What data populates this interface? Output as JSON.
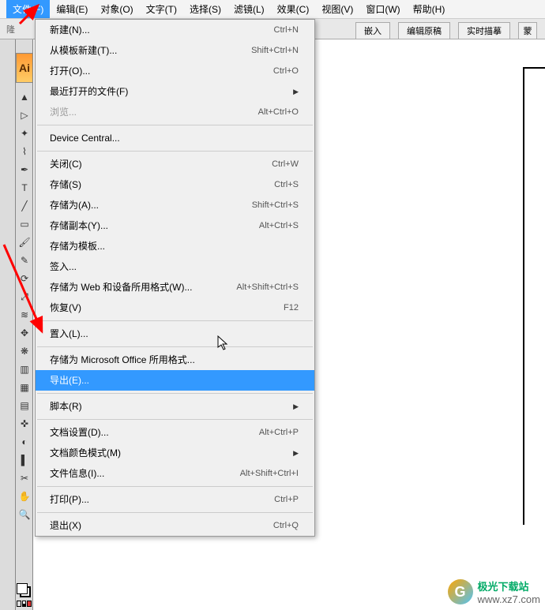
{
  "menubar": {
    "items": [
      {
        "label": "文件(F)",
        "active": true
      },
      {
        "label": "编辑(E)"
      },
      {
        "label": "对象(O)"
      },
      {
        "label": "文字(T)"
      },
      {
        "label": "选择(S)"
      },
      {
        "label": "滤镜(L)"
      },
      {
        "label": "效果(C)"
      },
      {
        "label": "视图(V)"
      },
      {
        "label": "窗口(W)"
      },
      {
        "label": "帮助(H)"
      }
    ]
  },
  "toolbar": {
    "embed": "嵌入",
    "edit_original": "编辑原稿",
    "live_trace": "实时描摹",
    "mask": "蒙"
  },
  "dropdown": {
    "items": [
      {
        "label": "新建(N)...",
        "shortcut": "Ctrl+N",
        "type": "item"
      },
      {
        "label": "从模板新建(T)...",
        "shortcut": "Shift+Ctrl+N",
        "type": "item"
      },
      {
        "label": "打开(O)...",
        "shortcut": "Ctrl+O",
        "type": "item"
      },
      {
        "label": "最近打开的文件(F)",
        "shortcut": "",
        "type": "submenu"
      },
      {
        "label": "浏览...",
        "shortcut": "Alt+Ctrl+O",
        "type": "item",
        "disabled": true
      },
      {
        "type": "sep"
      },
      {
        "label": "Device Central...",
        "shortcut": "",
        "type": "item"
      },
      {
        "type": "sep"
      },
      {
        "label": "关闭(C)",
        "shortcut": "Ctrl+W",
        "type": "item"
      },
      {
        "label": "存储(S)",
        "shortcut": "Ctrl+S",
        "type": "item"
      },
      {
        "label": "存储为(A)...",
        "shortcut": "Shift+Ctrl+S",
        "type": "item"
      },
      {
        "label": "存储副本(Y)...",
        "shortcut": "Alt+Ctrl+S",
        "type": "item"
      },
      {
        "label": "存储为模板...",
        "shortcut": "",
        "type": "item"
      },
      {
        "label": "签入...",
        "shortcut": "",
        "type": "item"
      },
      {
        "label": "存储为 Web 和设备所用格式(W)...",
        "shortcut": "Alt+Shift+Ctrl+S",
        "type": "item"
      },
      {
        "label": "恢复(V)",
        "shortcut": "F12",
        "type": "item"
      },
      {
        "type": "sep"
      },
      {
        "label": "置入(L)...",
        "shortcut": "",
        "type": "item"
      },
      {
        "type": "sep"
      },
      {
        "label": "存储为 Microsoft Office 所用格式...",
        "shortcut": "",
        "type": "item"
      },
      {
        "label": "导出(E)...",
        "shortcut": "",
        "type": "item",
        "highlighted": true
      },
      {
        "type": "sep"
      },
      {
        "label": "脚本(R)",
        "shortcut": "",
        "type": "submenu"
      },
      {
        "type": "sep"
      },
      {
        "label": "文档设置(D)...",
        "shortcut": "Alt+Ctrl+P",
        "type": "item"
      },
      {
        "label": "文档颜色模式(M)",
        "shortcut": "",
        "type": "submenu"
      },
      {
        "label": "文件信息(I)...",
        "shortcut": "Alt+Shift+Ctrl+I",
        "type": "item"
      },
      {
        "type": "sep"
      },
      {
        "label": "打印(P)...",
        "shortcut": "Ctrl+P",
        "type": "item"
      },
      {
        "type": "sep"
      },
      {
        "label": "退出(X)",
        "shortcut": "Ctrl+Q",
        "type": "item"
      }
    ]
  },
  "tools": {
    "ai_label": "Ai",
    "icons": [
      "selection",
      "direct-select",
      "wand",
      "lasso",
      "pen",
      "type",
      "line",
      "rect",
      "brush",
      "pencil",
      "rotate",
      "scale",
      "warp",
      "free",
      "symbol",
      "graph",
      "mesh",
      "gradient",
      "eyedrop",
      "blend",
      "slice",
      "scissors",
      "hand",
      "zoom"
    ]
  },
  "watermark": {
    "brand": "极光下载站",
    "url": "www.xz7.com",
    "logo": "G"
  },
  "left_label": "隆"
}
